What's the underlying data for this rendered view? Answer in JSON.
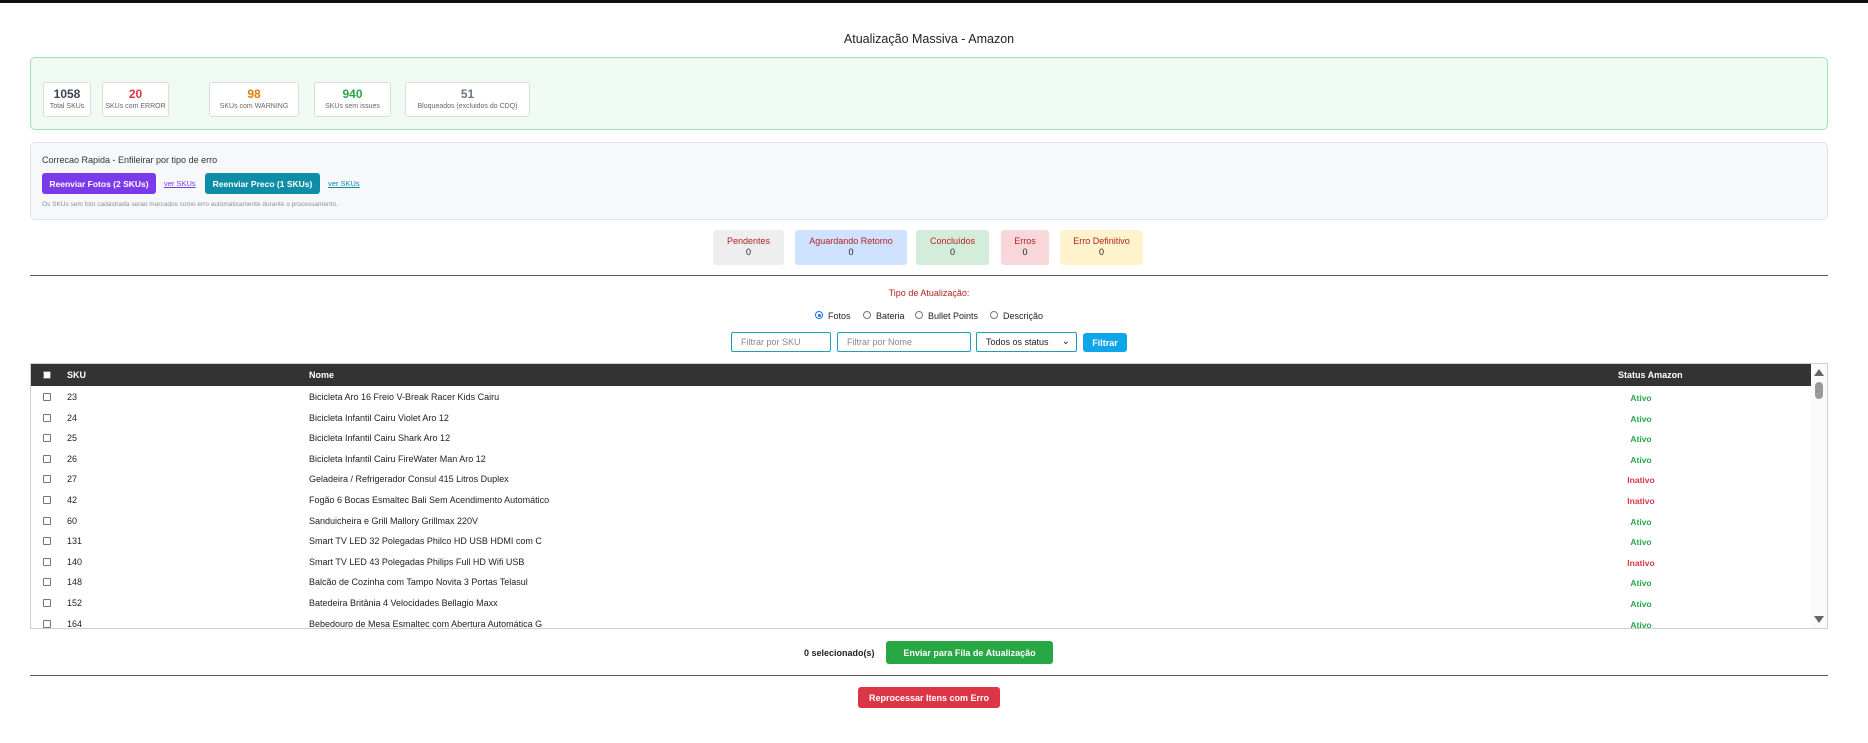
{
  "page": {
    "title": "Atualização Massiva - Amazon"
  },
  "summary": {
    "stats": [
      {
        "value": "1058",
        "label": "Total SKUs",
        "color": "#3a4556"
      },
      {
        "value": "20",
        "label": "SKUs com ERROR",
        "color": "#dc3545"
      },
      {
        "value": "98",
        "label": "SKUs com WARNING",
        "color": "#e67e00"
      },
      {
        "value": "940",
        "label": "SKUs sem issues",
        "color": "#28a745"
      },
      {
        "value": "51",
        "label": "Bloqueados (excluidos do CDQ)",
        "color": "#6c757d"
      }
    ]
  },
  "quickfix": {
    "title": "Correcao Rapida - Enfileirar por tipo de erro",
    "btn_fotos": "Reenviar Fotos (2 SKUs)",
    "link_fotos": "ver SKUs",
    "btn_preco": "Reenviar Preco (1 SKUs)",
    "link_preco": "ver SKUs",
    "note": "Os SKUs sem foto cadastrada serao marcados como erro automaticamente durante o processamento.",
    "colors": {
      "fotos": "#7c3aed",
      "preco": "#0e8ea6"
    }
  },
  "status_counters": [
    {
      "label": "Pendentes",
      "count": "0",
      "bg": "#eeeeee",
      "color": "#b22222"
    },
    {
      "label": "Aguardando Retorno",
      "count": "0",
      "bg": "#cfe2ff",
      "color": "#b22222"
    },
    {
      "label": "Concluídos",
      "count": "0",
      "bg": "#d4edda",
      "color": "#b22222"
    },
    {
      "label": "Erros",
      "count": "0",
      "bg": "#f8d7da",
      "color": "#b22222"
    },
    {
      "label": "Erro Definitivo",
      "count": "0",
      "bg": "#fff3cd",
      "color": "#b22222"
    }
  ],
  "update_type": {
    "label": "Tipo de Atualização:",
    "options": [
      "Fotos",
      "Bateria",
      "Bullet Points",
      "Descrição"
    ],
    "selected": "Fotos"
  },
  "filters": {
    "sku_placeholder": "Filtrar por SKU",
    "name_placeholder": "Filtrar por Nome",
    "status_value": "Todos os status",
    "button": "Filtrar"
  },
  "table": {
    "columns": [
      "SKU",
      "Nome",
      "Status Amazon"
    ],
    "rows": [
      {
        "sku": "23",
        "nome": "Bicicleta Aro 16 Freio V-Break Racer Kids Cairu",
        "status": "Ativo"
      },
      {
        "sku": "24",
        "nome": "Bicicleta Infantil Cairu Violet Aro 12",
        "status": "Ativo"
      },
      {
        "sku": "25",
        "nome": "Bicicleta Infantil Cairu Shark Aro 12",
        "status": "Ativo"
      },
      {
        "sku": "26",
        "nome": "Bicicleta Infantil Cairu FireWater Man Aro 12",
        "status": "Ativo"
      },
      {
        "sku": "27",
        "nome": "Geladeira / Refrigerador Consul 415 Litros Duplex",
        "status": "Inativo"
      },
      {
        "sku": "42",
        "nome": "Fogão 6 Bocas Esmaltec Bali Sem Acendimento Automático",
        "status": "Inativo"
      },
      {
        "sku": "60",
        "nome": "Sanduicheira e Grill Mallory Grillmax 220V",
        "status": "Ativo"
      },
      {
        "sku": "131",
        "nome": "Smart TV LED 32 Polegadas Philco HD USB HDMI com C",
        "status": "Ativo"
      },
      {
        "sku": "140",
        "nome": "Smart TV LED 43 Polegadas Philips Full HD Wifi USB",
        "status": "Inativo"
      },
      {
        "sku": "148",
        "nome": "Balcão de Cozinha com Tampo Novita 3 Portas Telasul",
        "status": "Ativo"
      },
      {
        "sku": "152",
        "nome": "Batedeira Britânia 4 Velocidades Bellagio Maxx",
        "status": "Ativo"
      },
      {
        "sku": "164",
        "nome": "Bebedouro de Mesa Esmaltec com Abertura Automática G",
        "status": "Ativo"
      }
    ],
    "status_colors": {
      "Ativo": "#28a745",
      "Inativo": "#dc3545"
    }
  },
  "footer": {
    "selected_count": "0 selecionado(s)",
    "send_button": "Enviar para Fila de Atualização",
    "reprocess_button": "Reprocessar Itens com Erro"
  }
}
